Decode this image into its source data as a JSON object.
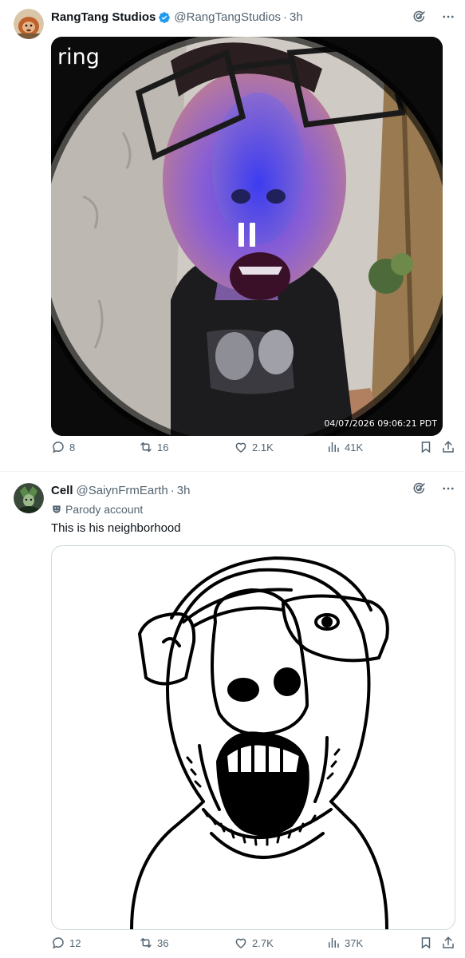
{
  "posts": [
    {
      "author": {
        "name": "RangTang Studios",
        "handle": "@RangTangStudios",
        "time": "3h",
        "verified": true
      },
      "media": {
        "logo": "ring",
        "timestamp": "04/07/2026 09:06:21 PDT",
        "overlay_icon": "pause-icon"
      },
      "stats": {
        "replies": "8",
        "reposts": "16",
        "likes": "2.1K",
        "views": "41K"
      }
    },
    {
      "author": {
        "name": "Cell",
        "handle": "@SaiynFrmEarth",
        "time": "3h",
        "verified": false
      },
      "badge": "Parody account",
      "text": "This is his neighborhood",
      "media": {
        "type": "wojak-drawing"
      },
      "stats": {
        "replies": "12",
        "reposts": "36",
        "likes": "2.7K",
        "views": "37K"
      }
    }
  ],
  "colors": {
    "text": "#0f1419",
    "secondary": "#536471",
    "verified": "#1d9bf0",
    "border": "#cfd9de"
  }
}
